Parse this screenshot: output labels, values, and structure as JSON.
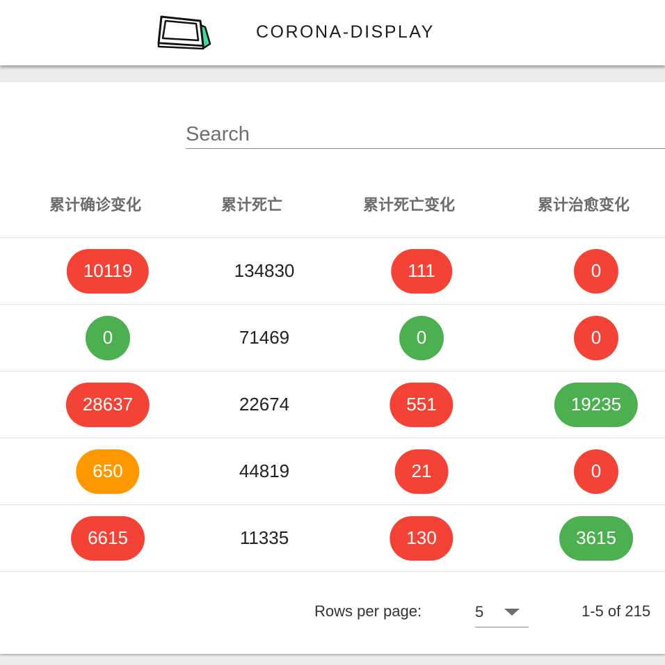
{
  "header": {
    "title": "CORONA-DISPLAY",
    "logo_icon": "display-device-icon"
  },
  "search": {
    "placeholder": "Search",
    "value": ""
  },
  "table": {
    "columns": [
      "累计确诊变化",
      "累计死亡",
      "累计死亡变化",
      "累计治愈变化"
    ],
    "rows": [
      {
        "confirmed_change": "10119",
        "confirmed_change_color": "red",
        "deaths": "134830",
        "deaths_change": "111",
        "deaths_change_color": "red",
        "cured_change": "0",
        "cured_change_color": "red"
      },
      {
        "confirmed_change": "0",
        "confirmed_change_color": "green",
        "deaths": "71469",
        "deaths_change": "0",
        "deaths_change_color": "green",
        "cured_change": "0",
        "cured_change_color": "red"
      },
      {
        "confirmed_change": "28637",
        "confirmed_change_color": "red",
        "deaths": "22674",
        "deaths_change": "551",
        "deaths_change_color": "red",
        "cured_change": "19235",
        "cured_change_color": "green"
      },
      {
        "confirmed_change": "650",
        "confirmed_change_color": "orange",
        "deaths": "44819",
        "deaths_change": "21",
        "deaths_change_color": "red",
        "cured_change": "0",
        "cured_change_color": "red"
      },
      {
        "confirmed_change": "6615",
        "confirmed_change_color": "red",
        "deaths": "11335",
        "deaths_change": "130",
        "deaths_change_color": "red",
        "cured_change": "3615",
        "cured_change_color": "green"
      }
    ]
  },
  "pagination": {
    "rows_per_page_label": "Rows per page:",
    "rows_per_page": "5",
    "range": "1-5 of 215"
  },
  "colors": {
    "red": "#f44336",
    "green": "#4caf50",
    "orange": "#ff9800",
    "header_text": "#6b6b6b"
  }
}
